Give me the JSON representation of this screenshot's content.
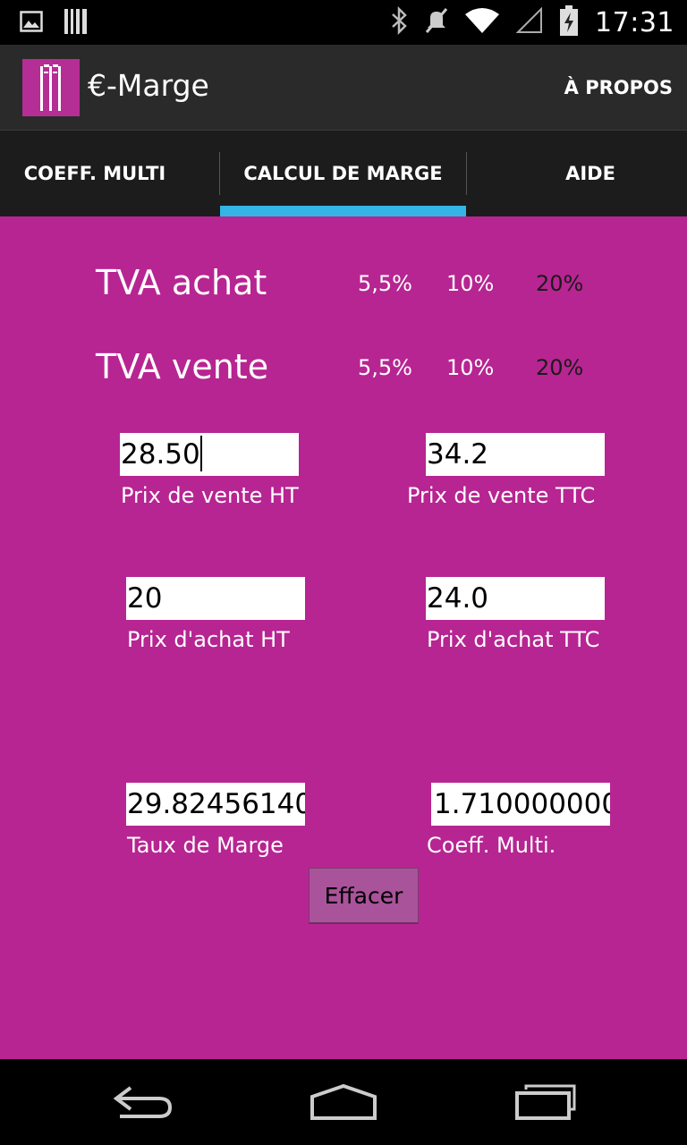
{
  "status_bar": {
    "time": "17:31",
    "left_icons": [
      "image-notification-icon",
      "barcode-notification-icon"
    ],
    "right_icons": [
      "bluetooth-icon",
      "muted-icon",
      "wifi-icon",
      "battery-charging-icon"
    ]
  },
  "action_bar": {
    "title": "€-Marge",
    "about_label": "À PROPOS"
  },
  "tabs": [
    {
      "label": "COEFF. MULTI",
      "selected": false
    },
    {
      "label": "CALCUL DE MARGE",
      "selected": true
    },
    {
      "label": "AIDE",
      "selected": false
    }
  ],
  "tva_achat": {
    "label": "TVA achat",
    "rates": [
      "5,5%",
      "10%",
      "20%"
    ]
  },
  "tva_vente": {
    "label": "TVA vente",
    "rates": [
      "5,5%",
      "10%",
      "20%"
    ]
  },
  "fields": {
    "prix_vente_ht": {
      "value": "28.50",
      "label": "Prix de vente HT"
    },
    "prix_vente_ttc": {
      "value": "34.2",
      "label": "Prix de vente TTC"
    },
    "prix_achat_ht": {
      "value": "20",
      "label": "Prix d'achat HT"
    },
    "prix_achat_ttc": {
      "value": "24.0",
      "label": "Prix d'achat TTC"
    },
    "taux_marge": {
      "value": "29.82456140",
      "label": "Taux de Marge"
    },
    "coeff_multi": {
      "value": "1.710000000",
      "label": "Coeff. Multi."
    }
  },
  "clear_button": "Effacer",
  "colors": {
    "content_bg": "#b72592",
    "tab_indicator": "#33b5e5",
    "action_bar": "#2a2a2a",
    "button": "#a9539a"
  }
}
